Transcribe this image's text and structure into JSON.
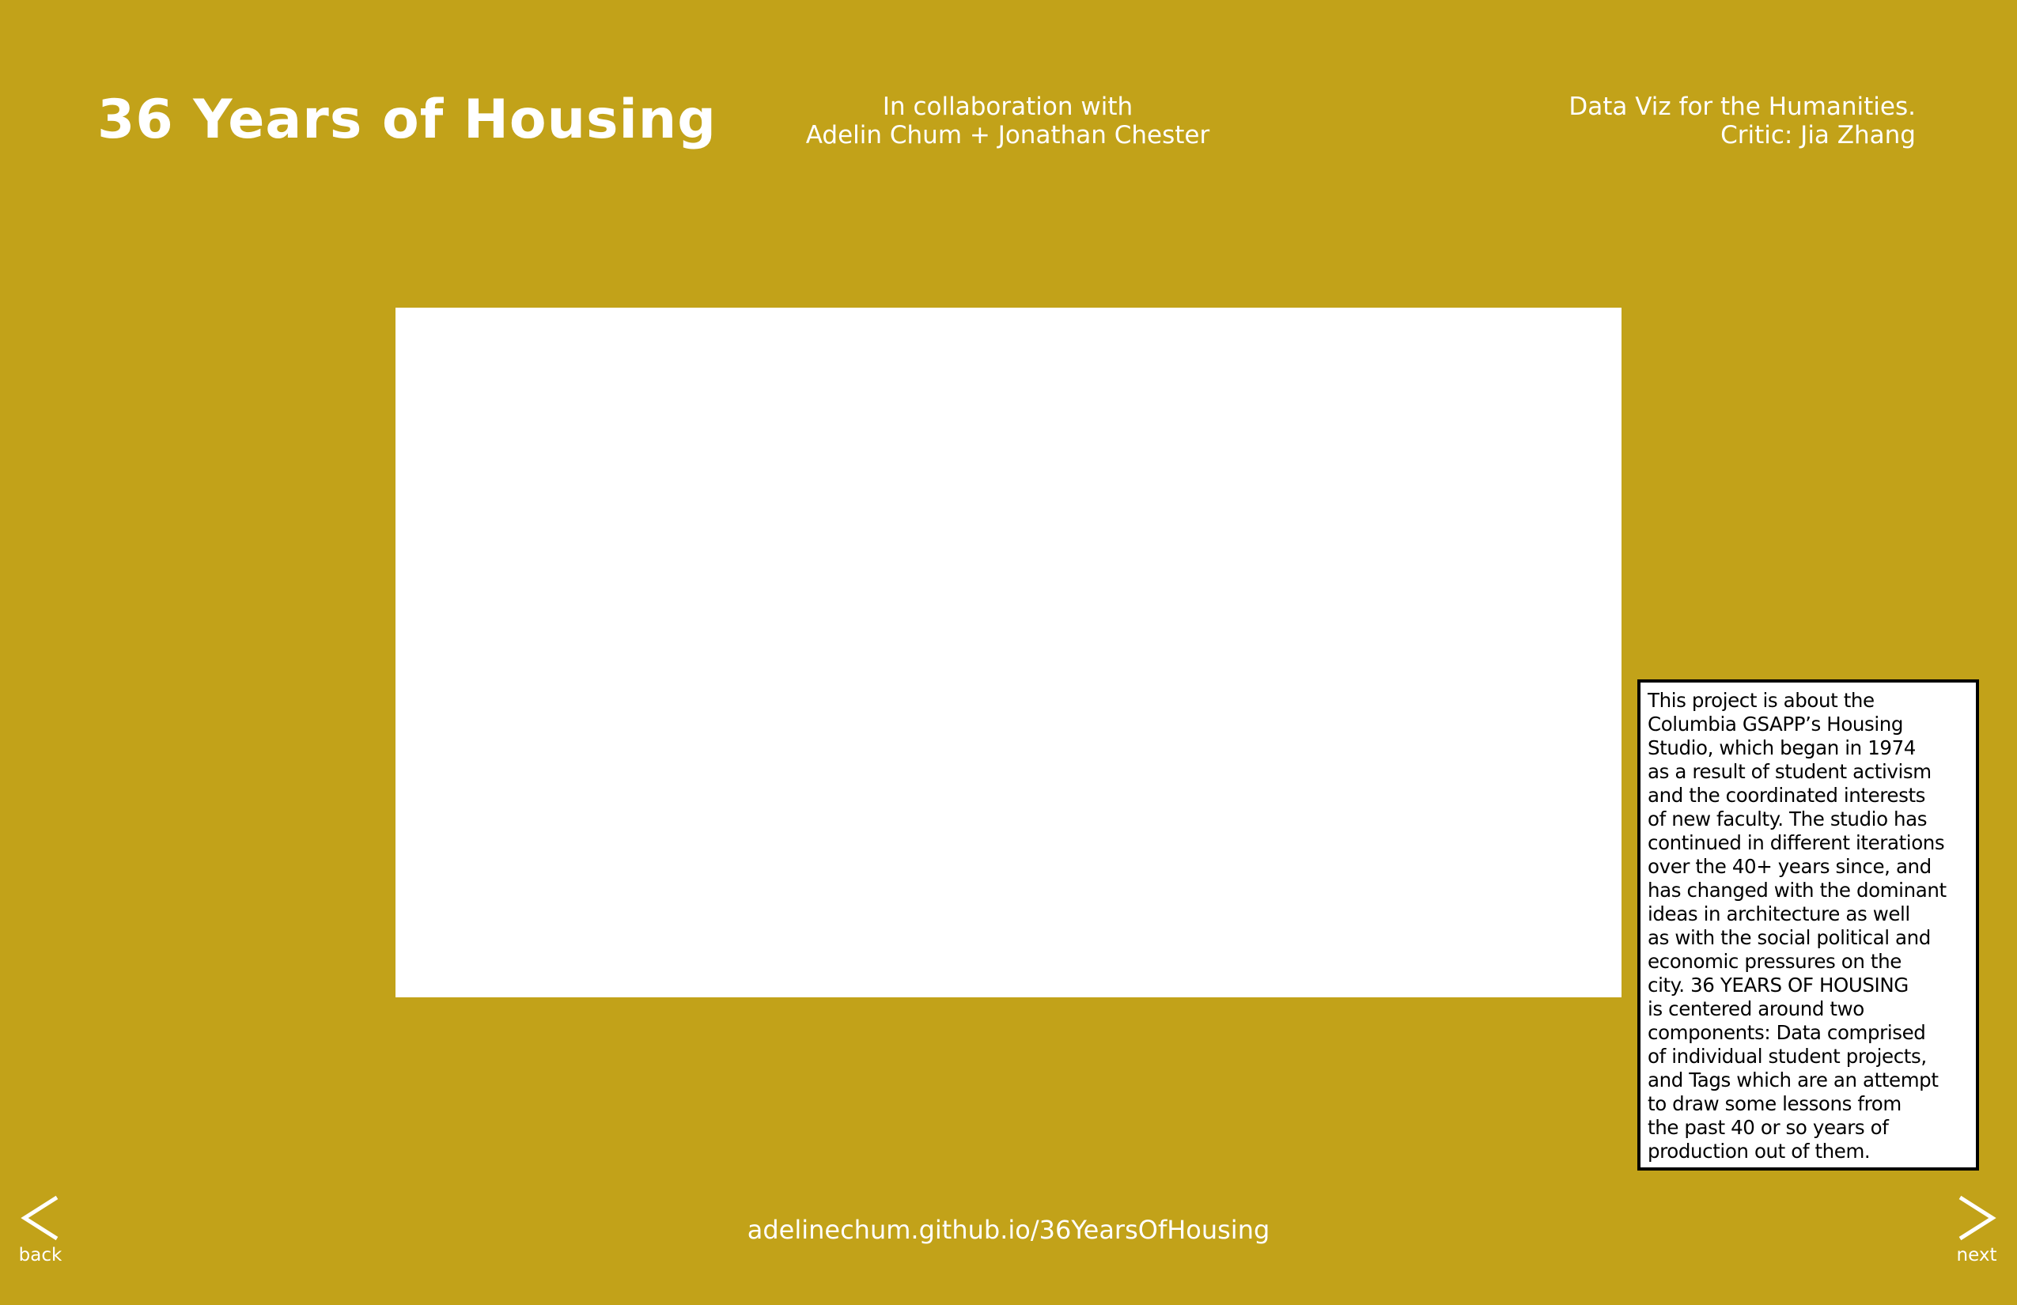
{
  "page": {
    "background_color": "#c2a219",
    "text_color": "#ffffff"
  },
  "header": {
    "title": "36 Years of Housing",
    "collab_line1": "In collaboration with",
    "collab_line2": "Adelin Chum + Jonathan Chester",
    "course_line1": "Data Viz for the Humanities.",
    "course_line2": "Critic: Jia Zhang"
  },
  "description": {
    "lines": [
      "This project is about the",
      "Columbia GSAPP’s Housing",
      "Studio, which began in 1974",
      "as a result of student activism",
      "and the coordinated interests",
      "of new faculty. The studio has",
      "continued in different iterations",
      "over the 40+ years since, and",
      "has changed with the dominant",
      "ideas in architecture as well",
      "as with the social political and",
      "economic pressures on the",
      "city. 36 YEARS OF HOUSING",
      "is centered around two",
      "components: Data comprised",
      "of individual student projects,",
      "and Tags which are an attempt",
      "to draw some lessons from",
      "the past 40 or so years of",
      "production out of them."
    ]
  },
  "footer": {
    "url": "adelinechum.github.io/36YearsOfHousing"
  },
  "nav": {
    "back_label": "back",
    "back_icon": "chevron-left-icon",
    "next_label": "next",
    "next_icon": "chevron-right-icon"
  }
}
